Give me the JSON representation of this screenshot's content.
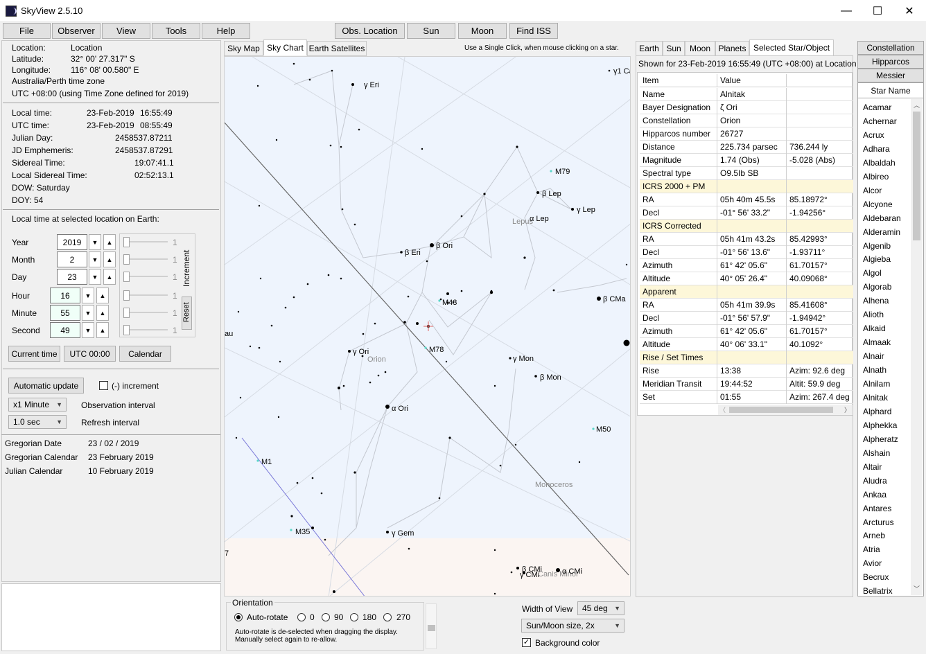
{
  "window": {
    "title": "SkyView   2.5.10",
    "minimize": "—",
    "maximize": "☐",
    "close": "✕"
  },
  "menu": {
    "file": "File",
    "observer": "Observer",
    "view": "View",
    "tools": "Tools",
    "help": "Help"
  },
  "toolbar": {
    "obs_location": "Obs. Location",
    "sun": "Sun",
    "moon": "Moon",
    "find_iss": "Find ISS"
  },
  "location": {
    "location_label": "Location:",
    "location_value": "Location",
    "latitude_label": "Latitude:",
    "latitude_value": "32° 00' 27.317\" S",
    "longitude_label": "Longitude:",
    "longitude_value": "116° 08' 00.580\" E",
    "timezone": "Australia/Perth time zone",
    "utc_offset": "UTC +08:00    (using Time Zone defined for 2019)"
  },
  "times": {
    "local_time_label": "Local time:",
    "local_time_date": "23-Feb-2019",
    "local_time_time": "16:55:49",
    "utc_time_label": "UTC time:",
    "utc_time_date": "23-Feb-2019",
    "utc_time_time": "08:55:49",
    "julian_day_label": "Julian Day:",
    "julian_day_value": "2458537.87211",
    "jd_ephemeris_label": "JD Emphemeris:",
    "jd_ephemeris_value": "2458537.87291",
    "sidereal_label": "Sidereal Time:",
    "sidereal_value": "19:07:41.1",
    "local_sidereal_label": "Local Sidereal Time:",
    "local_sidereal_value": "02:52:13.1",
    "dow": "DOW:    Saturday",
    "doy": "DOY:  54"
  },
  "selected_time": {
    "heading": "Local time at selected location on Earth:",
    "rows": [
      {
        "label": "Year",
        "value": "2019",
        "slider": "1"
      },
      {
        "label": "Month",
        "value": "2",
        "slider": "1"
      },
      {
        "label": "Day",
        "value": "23",
        "slider": "1"
      },
      {
        "label": "Hour",
        "value": "16",
        "slider": "1"
      },
      {
        "label": "Minute",
        "value": "55",
        "slider": "1"
      },
      {
        "label": "Second",
        "value": "49",
        "slider": "1"
      }
    ],
    "increment_label": "Increment",
    "reset": "Reset",
    "current_time": "Current time",
    "utc_zero": "UTC 00:00",
    "calendar": "Calendar",
    "automatic_update": "Automatic update",
    "neg_increment": "(-) increment",
    "obs_interval_value": "x1 Minute",
    "obs_interval_label": "Observation interval",
    "refresh_value": "1.0 sec",
    "refresh_label": "Refresh interval"
  },
  "calendar": {
    "gregorian_date_label": "Gregorian Date",
    "gregorian_date_value": "23 / 02 / 2019",
    "gregorian_cal_label": "Gregorian Calendar",
    "gregorian_cal_value": "23 February 2019",
    "julian_cal_label": "Julian Calendar",
    "julian_cal_value": "10 February 2019"
  },
  "chart_tabs": {
    "sky_map": "Sky Map",
    "sky_chart": "Sky Chart",
    "earth_sat": "Earth Satellites",
    "hint": "Use a Single Click, when mouse clicking on a star."
  },
  "chart_labels": {
    "g_eri": "γ Eri",
    "g1_cae": "γ1 Ca",
    "m79": "M79",
    "b_lep": "β Lep",
    "g_lep": "γ Lep",
    "lepus": "Lepus",
    "a_lep": "α Lep",
    "b_ori": "β Ori",
    "b_eri": "β Eri",
    "m42": "M43",
    "b_cma": "β CMa",
    "g_ori": "γ Ori",
    "orion": "Orion",
    "m78": "M78",
    "g_mon": "γ Mon",
    "b_mon": "β Mon",
    "a_ori": "α Ori",
    "m50": "M50",
    "m1": "M1",
    "monoceros": "Monoceros",
    "m35": "M35",
    "g_gem": "γ Gem",
    "b_cmi": "β CMi",
    "g_cmi": "γ CMi",
    "a_cmi": "α CMi",
    "canis_minor": "Canis Minor",
    "tau": "au",
    "seven": "7"
  },
  "orientation": {
    "title": "Orientation",
    "auto": "Auto-rotate",
    "o0": "0",
    "o90": "90",
    "o180": "180",
    "o270": "270",
    "note1": "Auto-rotate is de-selected when dragging the display.",
    "note2": "Manually select again to re-allow."
  },
  "view_opts": {
    "width_label": "Width of View",
    "width_value": "45 deg",
    "sunmoon": "Sun/Moon size, 2x",
    "bgcolor": "Background color"
  },
  "info_tabs": {
    "earth": "Earth",
    "sun": "Sun",
    "moon": "Moon",
    "planets": "Planets",
    "selected": "Selected Star/Object"
  },
  "info": {
    "shown_for": "Shown for 23-Feb-2019 16:55:49 (UTC +08:00) at Location",
    "col_item": "Item",
    "col_value": "Value",
    "rows": [
      {
        "item": "Name",
        "v1": "Alnitak",
        "v2": "",
        "sec": false
      },
      {
        "item": "Bayer Designation",
        "v1": "ζ  Ori",
        "v2": "",
        "sec": false
      },
      {
        "item": "Constellation",
        "v1": "Orion",
        "v2": "",
        "sec": false
      },
      {
        "item": "Hipparcos number",
        "v1": "26727",
        "v2": "",
        "sec": false
      },
      {
        "item": "Distance",
        "v1": "225.734 parsec",
        "v2": "736.244 ly",
        "sec": false
      },
      {
        "item": "Magnitude",
        "v1": "1.74   (Obs)",
        "v2": "-5.028   (Abs)",
        "sec": false
      },
      {
        "item": "Spectral type",
        "v1": "O9.5Ib SB",
        "v2": "",
        "sec": false
      },
      {
        "item": "ICRS 2000 + PM",
        "v1": "",
        "v2": "",
        "sec": true
      },
      {
        "item": "RA",
        "v1": "05h 40m 45.5s",
        "v2": "85.18972°",
        "sec": false
      },
      {
        "item": "Decl",
        "v1": "-01° 56' 33.2\"",
        "v2": "-1.94256°",
        "sec": false
      },
      {
        "item": "ICRS Corrected",
        "v1": "",
        "v2": "",
        "sec": true
      },
      {
        "item": "RA",
        "v1": "05h 41m 43.2s",
        "v2": "85.42993°",
        "sec": false
      },
      {
        "item": "Decl",
        "v1": "-01° 56' 13.6\"",
        "v2": "-1.93711°",
        "sec": false
      },
      {
        "item": "Azimuth",
        "v1": "61° 42' 05.6\"",
        "v2": "61.70157°",
        "sec": false
      },
      {
        "item": "Altitude",
        "v1": "40° 05' 26.4\"",
        "v2": "40.09068°",
        "sec": false
      },
      {
        "item": "Apparent",
        "v1": "",
        "v2": "",
        "sec": true
      },
      {
        "item": "RA",
        "v1": "05h 41m 39.9s",
        "v2": "85.41608°",
        "sec": false
      },
      {
        "item": "Decl",
        "v1": "-01° 56' 57.9\"",
        "v2": "-1.94942°",
        "sec": false
      },
      {
        "item": "Azimuth",
        "v1": "61° 42' 05.6\"",
        "v2": "61.70157°",
        "sec": false
      },
      {
        "item": "Altitude",
        "v1": "40° 06' 33.1\"",
        "v2": "40.1092°",
        "sec": false
      },
      {
        "item": "Rise / Set Times",
        "v1": "",
        "v2": "",
        "sec": true
      },
      {
        "item": "Rise",
        "v1": "13:38",
        "v2": "Azim: 92.6 deg",
        "sec": false
      },
      {
        "item": "Meridian Transit",
        "v1": "19:44:52",
        "v2": "Altit:  59.9 deg",
        "sec": false
      },
      {
        "item": "Set",
        "v1": "01:55",
        "v2": "Azim: 267.4 deg",
        "sec": false
      }
    ]
  },
  "right_tabs": {
    "constellation": "Constellation",
    "hipparcos": "Hipparcos",
    "messier": "Messier",
    "star_name": "Star Name"
  },
  "star_names": [
    "Acamar",
    "Achernar",
    "Acrux",
    "Adhara",
    "Albaldah",
    "Albireo",
    "Alcor",
    "Alcyone",
    "Aldebaran",
    "Alderamin",
    "Algenib",
    "Algieba",
    "Algol",
    "Algorab",
    "Alhena",
    "Alioth",
    "Alkaid",
    "Almaak",
    "Alnair",
    "Alnath",
    "Alnilam",
    "Alnitak",
    "Alphard",
    "Alphekka",
    "Alpheratz",
    "Alshain",
    "Altair",
    "Aludra",
    "Ankaa",
    "Antares",
    "Arcturus",
    "Arneb",
    "Atria",
    "Avior",
    "Becrux",
    "Bellatrix"
  ]
}
